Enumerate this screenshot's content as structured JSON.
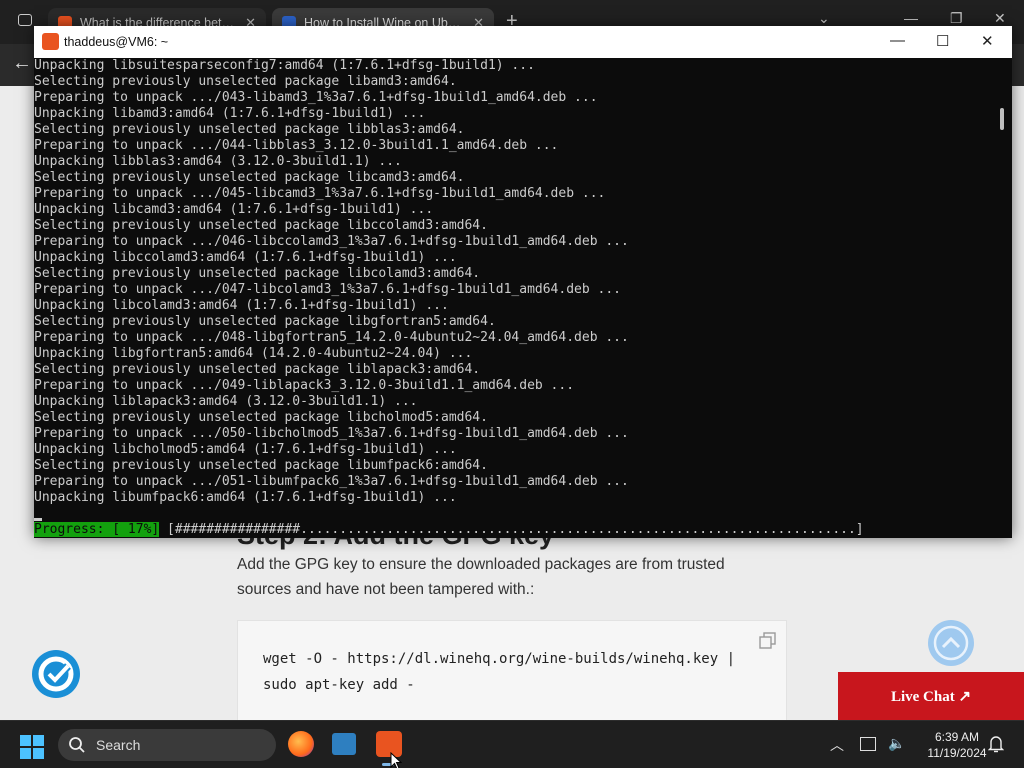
{
  "browser": {
    "tabs": [
      {
        "title": "What is the difference between",
        "favicon_color": "#e8501f"
      },
      {
        "title": "How to Install Wine on Ubuntu",
        "favicon_color": "#2c62c9"
      }
    ],
    "new_tab_icon": "plus-icon"
  },
  "webpage": {
    "heading": "Step 2: Add the GPG key",
    "paragraph": "Add the GPG key to ensure the downloaded packages are from trusted sources and have not been tampered with.:",
    "code": "wget -O - https://dl.winehq.org/wine-builds/winehq.key | sudo apt-key add -",
    "live_chat_label": "Live Chat ↗",
    "accent_color": "#c8161d"
  },
  "terminal": {
    "title": "thaddeus@VM6: ~",
    "lines": [
      "Unpacking libsuitesparseconfig7:amd64 (1:7.6.1+dfsg-1build1) ...",
      "Selecting previously unselected package libamd3:amd64.",
      "Preparing to unpack .../043-libamd3_1%3a7.6.1+dfsg-1build1_amd64.deb ...",
      "Unpacking libamd3:amd64 (1:7.6.1+dfsg-1build1) ...",
      "Selecting previously unselected package libblas3:amd64.",
      "Preparing to unpack .../044-libblas3_3.12.0-3build1.1_amd64.deb ...",
      "Unpacking libblas3:amd64 (3.12.0-3build1.1) ...",
      "Selecting previously unselected package libcamd3:amd64.",
      "Preparing to unpack .../045-libcamd3_1%3a7.6.1+dfsg-1build1_amd64.deb ...",
      "Unpacking libcamd3:amd64 (1:7.6.1+dfsg-1build1) ...",
      "Selecting previously unselected package libccolamd3:amd64.",
      "Preparing to unpack .../046-libccolamd3_1%3a7.6.1+dfsg-1build1_amd64.deb ...",
      "Unpacking libccolamd3:amd64 (1:7.6.1+dfsg-1build1) ...",
      "Selecting previously unselected package libcolamd3:amd64.",
      "Preparing to unpack .../047-libcolamd3_1%3a7.6.1+dfsg-1build1_amd64.deb ...",
      "Unpacking libcolamd3:amd64 (1:7.6.1+dfsg-1build1) ...",
      "Selecting previously unselected package libgfortran5:amd64.",
      "Preparing to unpack .../048-libgfortran5_14.2.0-4ubuntu2~24.04_amd64.deb ...",
      "Unpacking libgfortran5:amd64 (14.2.0-4ubuntu2~24.04) ...",
      "Selecting previously unselected package liblapack3:amd64.",
      "Preparing to unpack .../049-liblapack3_3.12.0-3build1.1_amd64.deb ...",
      "Unpacking liblapack3:amd64 (3.12.0-3build1.1) ...",
      "Selecting previously unselected package libcholmod5:amd64.",
      "Preparing to unpack .../050-libcholmod5_1%3a7.6.1+dfsg-1build1_amd64.deb ...",
      "Unpacking libcholmod5:amd64 (1:7.6.1+dfsg-1build1) ...",
      "Selecting previously unselected package libumfpack6:amd64.",
      "Preparing to unpack .../051-libumfpack6_1%3a7.6.1+dfsg-1build1_amd64.deb ...",
      "Unpacking libumfpack6:amd64 (1:7.6.1+dfsg-1build1) ..."
    ],
    "progress_label": "Progress: [ 17%]",
    "progress_bar": " [################.......................................................................]",
    "progress_percent": 17,
    "progress_color": "#13a10e"
  },
  "taskbar": {
    "search_placeholder": "Search",
    "time": "6:39 AM",
    "date": "11/19/2024",
    "apps": [
      "firefox-icon",
      "vscode-icon",
      "ubuntu-terminal-icon"
    ]
  }
}
